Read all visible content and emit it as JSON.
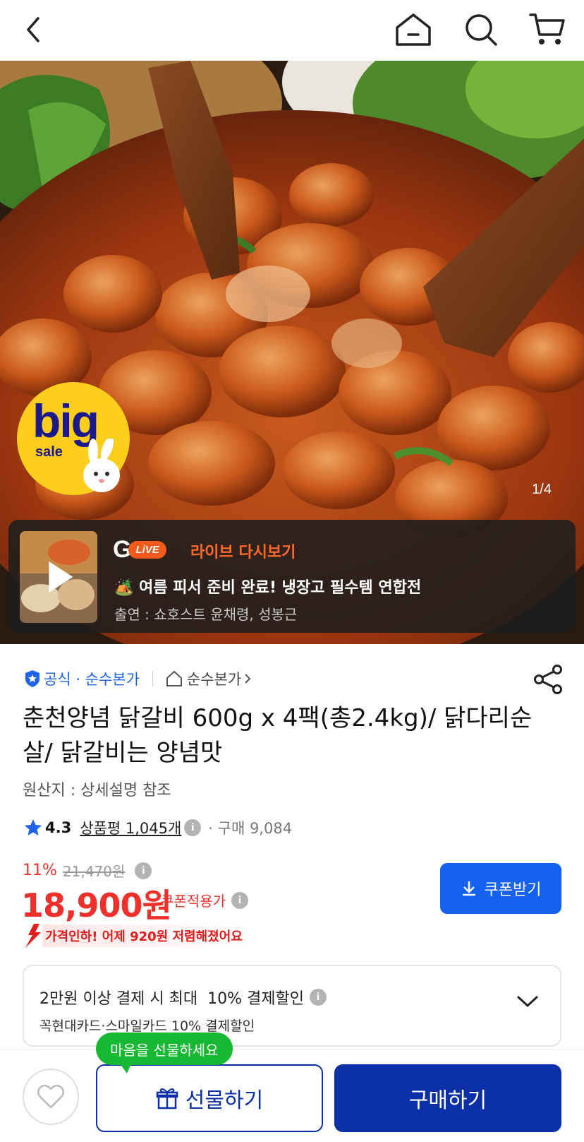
{
  "nav": {
    "back_icon": "chevron-left-icon",
    "home_icon": "home-icon",
    "search_icon": "search-icon",
    "cart_icon": "cart-icon"
  },
  "hero": {
    "pager": "1/4",
    "badge_big": "big",
    "badge_sale": "sale"
  },
  "live": {
    "logo_g": "G",
    "logo_pill": "LiVE",
    "replay_label": "라이브 다시보기",
    "title": "🏕️ 여름 피서 준비 완료! 냉장고 필수템 연합전",
    "cast": "출연 : 쇼호스트 윤채령, 성봉근"
  },
  "product": {
    "tag_official": "공식 · 순수본가",
    "tag_store": "순수본가",
    "title": "춘천양념 닭갈비 600g x 4팩(총2.4kg)/ 닭다리순살/ 닭갈비는 양념맛",
    "origin": "원산지 : 상세설명 참조",
    "rating": "4.3",
    "review_label": "상품평 1,045개",
    "buy_count": "· 구매 9,084",
    "discount_rate": "11%",
    "original_price": "21,470원",
    "price": "18,900원",
    "coupon_price_label": "쿠폰적용가",
    "coupon_button": "쿠폰받기",
    "price_drop": "가격인하! 어제 920원 저렴해졌어요"
  },
  "payment": {
    "line1": "2만원 이상 결제 시 최대  10% 결제할인",
    "line2": "꼭현대카드·스마일카드 10% 결제할인"
  },
  "bottom": {
    "tooltip": "마음을 선물하세요",
    "gift_label": "선물하기",
    "buy_label": "구매하기"
  },
  "colors": {
    "accent_blue": "#1662f0",
    "navy": "#0a2fa6",
    "price_red": "#f0302a",
    "live_orange": "#ff6a2b",
    "tooltip_green": "#17b832",
    "badge_yellow": "#ffcd1c"
  }
}
